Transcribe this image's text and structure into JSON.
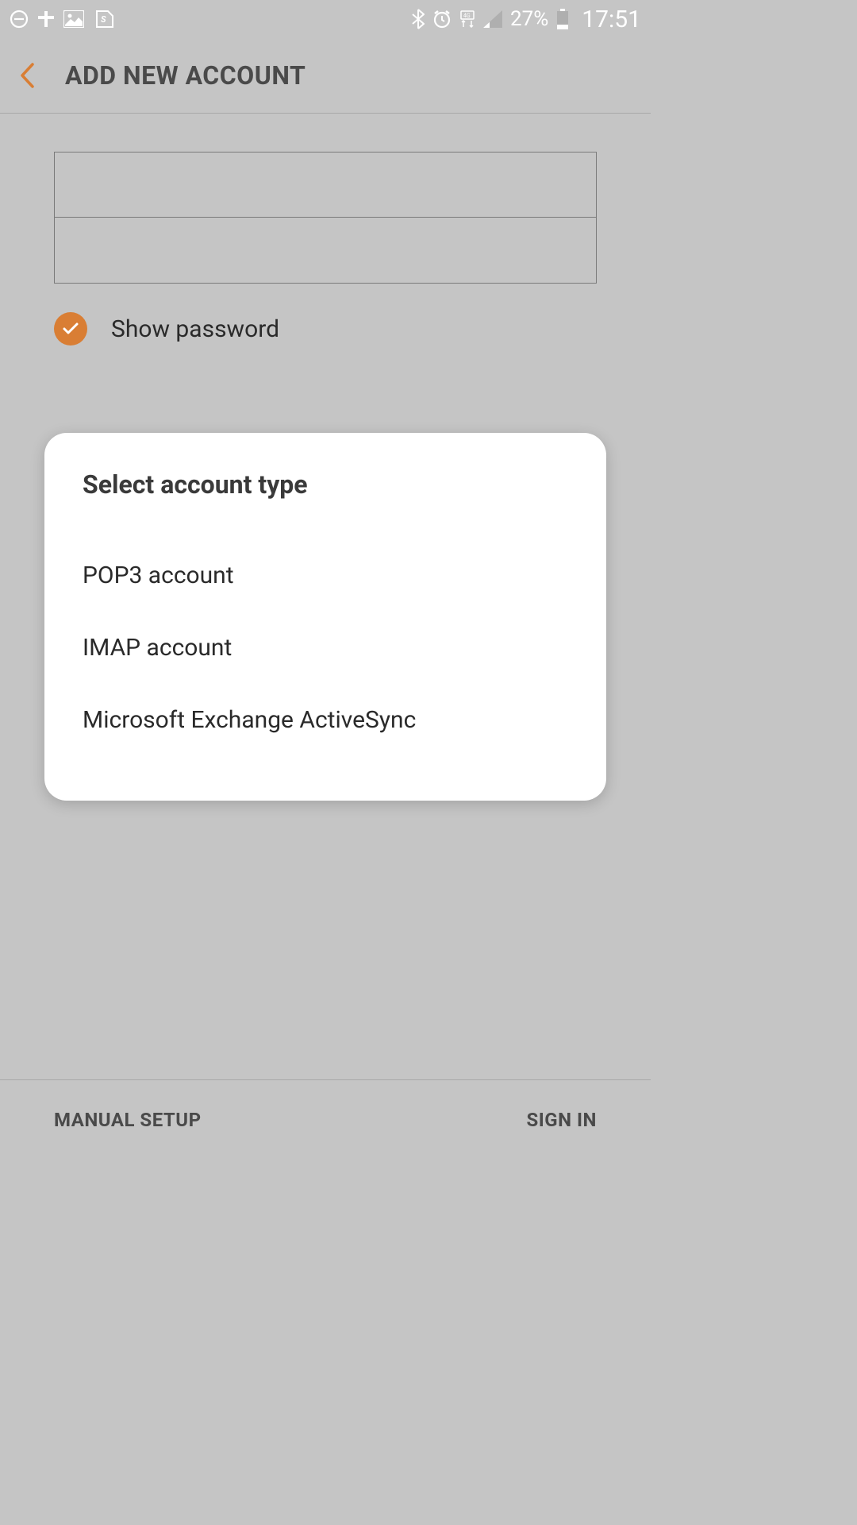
{
  "status_bar": {
    "battery_percent": "27%",
    "time": "17:51"
  },
  "header": {
    "title": "ADD NEW ACCOUNT"
  },
  "form": {
    "email_value": "",
    "password_value": "",
    "show_password_label": "Show password",
    "show_password_checked": true
  },
  "modal": {
    "title": "Select account type",
    "options": [
      "POP3 account",
      "IMAP account",
      "Microsoft Exchange ActiveSync"
    ]
  },
  "bottom_bar": {
    "manual_setup": "MANUAL SETUP",
    "sign_in": "SIGN IN"
  }
}
